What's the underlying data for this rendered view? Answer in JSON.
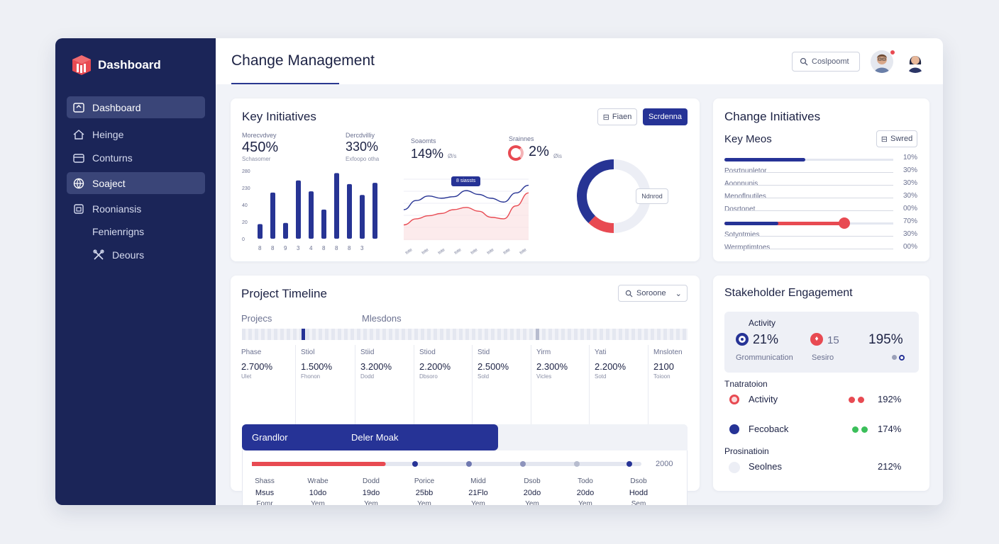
{
  "brand": {
    "title": "Dashboard"
  },
  "sidebar": {
    "items": [
      {
        "label": "Dashboard",
        "icon": "home-icon",
        "active": true
      },
      {
        "label": "Heinge",
        "icon": "house-icon",
        "active": false
      },
      {
        "label": "Conturns",
        "icon": "folder-icon",
        "active": false
      },
      {
        "label": "Soaject",
        "icon": "globe-icon",
        "active": true
      },
      {
        "label": "Rooniansis",
        "icon": "calendar-icon",
        "active": false
      },
      {
        "label": "Fenienrigns",
        "icon": "",
        "active": false
      },
      {
        "label": "Deours",
        "icon": "tools-icon",
        "active": false
      }
    ]
  },
  "header": {
    "title": "Change Management",
    "search_label": "Coslpoomt"
  },
  "key_initiatives": {
    "title": "Key Initiatives",
    "filter_button": "Fiaen",
    "primary_button": "Scrdenna",
    "metrics": [
      {
        "label": "Morecvdvey",
        "value": "450%",
        "sub": "Schasomer"
      },
      {
        "label": "Dercdvilliy",
        "value": "330%",
        "sub": "Exfoopo otha"
      },
      {
        "label": "Soaomts",
        "value": "149%",
        "suffix": "Ø/s"
      },
      {
        "label": "Srainnes",
        "value": "2%",
        "suffix": "Øis"
      }
    ],
    "bar_chart": {
      "type": "bar",
      "y_ticks": [
        "280",
        "230",
        "40",
        "20",
        "0"
      ],
      "categories": [
        "8",
        "8",
        "9",
        "3",
        "4",
        "8",
        "8",
        "8",
        "3"
      ],
      "values": [
        60,
        190,
        65,
        240,
        195,
        120,
        270,
        225,
        180,
        230
      ],
      "ylim": [
        0,
        280
      ]
    },
    "line_chart": {
      "type": "line",
      "x_labels": [
        "tote",
        "tote",
        "tote",
        "tote",
        "tote",
        "tote",
        "tote",
        "tote"
      ],
      "tooltip": "8 siassts",
      "series": [
        {
          "values": [
            40,
            52,
            58,
            55,
            57,
            65,
            60,
            55,
            50,
            62,
            72
          ]
        },
        {
          "values": [
            20,
            28,
            32,
            35,
            40,
            43,
            38,
            30,
            28,
            45,
            62
          ]
        }
      ]
    },
    "donut": {
      "type": "pie",
      "label": "Ndnrod",
      "slices": [
        {
          "value": 38,
          "color": "#273494"
        },
        {
          "value": 12,
          "color": "#e84a52"
        },
        {
          "value": 50,
          "color": "#eceef5"
        }
      ]
    }
  },
  "change_initiatives": {
    "title": "Change Initiatives",
    "subtitle": "Key Meos",
    "button": "Swred",
    "rows": [
      {
        "label": "",
        "pct": "10%",
        "fill": 0.48,
        "color": "#263396"
      },
      {
        "label": "Posrtnunletor",
        "pct": "30%",
        "fill": 0,
        "color": ""
      },
      {
        "label": "Aoonnunis",
        "pct": "30%",
        "fill": 0,
        "color": ""
      },
      {
        "label": "Menoflnutiles",
        "pct": "30%",
        "fill": 0,
        "color": ""
      },
      {
        "label": "Dosrtonet",
        "pct": "00%",
        "fill": 0,
        "color": ""
      },
      {
        "label": "",
        "pct": "70%",
        "fill": 0.71,
        "color": "#e84a52"
      },
      {
        "label": "Sotyntmies",
        "pct": "30%",
        "fill": 0,
        "color": ""
      },
      {
        "label": "Wermptimtoes",
        "pct": "00%",
        "fill": 0,
        "color": ""
      }
    ]
  },
  "timeline": {
    "title": "Project Timeline",
    "dropdown": "Soroone",
    "col_projects": "Projecs",
    "col_milestones": "Mlesdons",
    "phases": [
      {
        "head": "Phase",
        "value": "2.700%",
        "sub": "Ulet"
      },
      {
        "head": "Stiol",
        "value": "1.500%",
        "sub": "Fhonon"
      },
      {
        "head": "Stiid",
        "value": "3.200%",
        "sub": "Dodd"
      },
      {
        "head": "Stiod",
        "value": "2.200%",
        "sub": "Dbsoro"
      },
      {
        "head": "Stid",
        "value": "2.500%",
        "sub": "Sold"
      },
      {
        "head": "Yirm",
        "value": "2.300%",
        "sub": "Vicles"
      },
      {
        "head": "Yati",
        "value": "2.200%",
        "sub": "Sotd"
      },
      {
        "head": "Mnsloten",
        "value": "2100",
        "sub": "Toioon"
      }
    ],
    "gantt_left": "Grandlor",
    "gantt_right": "Deler Moak",
    "year": "2000",
    "progress": 0.34,
    "milestones": [
      {
        "a": "Shass",
        "b": "Msus",
        "c": "Fomr"
      },
      {
        "a": "Wrabe",
        "b": "10do",
        "c": "Yem"
      },
      {
        "a": "Dodd",
        "b": "19do",
        "c": "Yem"
      },
      {
        "a": "Porice",
        "b": "25bb",
        "c": "Yem"
      },
      {
        "a": "Midd",
        "b": "21Flo",
        "c": "Yem"
      },
      {
        "a": "Dsob",
        "b": "20do",
        "c": "Yem"
      },
      {
        "a": "Todo",
        "b": "20do",
        "c": "Yem"
      },
      {
        "a": "Dsob",
        "b": "Hodd",
        "c": "Sem"
      }
    ]
  },
  "stakeholder": {
    "title": "Stakeholder Engagement",
    "activity_title": "Activity",
    "stats": [
      {
        "value": "21%",
        "sub": "Grommunication"
      },
      {
        "value": "15",
        "sub": "Sesiro"
      },
      {
        "value": "195%",
        "sub": ""
      }
    ],
    "section1": "Tnatratoion",
    "rows": [
      {
        "label": "Activity",
        "pct": "192%",
        "color": "#e84a52"
      },
      {
        "label": "Fecoback",
        "pct": "174%",
        "color": "#263396"
      }
    ],
    "section2": "Prosinatioin",
    "row3": {
      "label": "Seolnes",
      "pct": "212%"
    }
  }
}
